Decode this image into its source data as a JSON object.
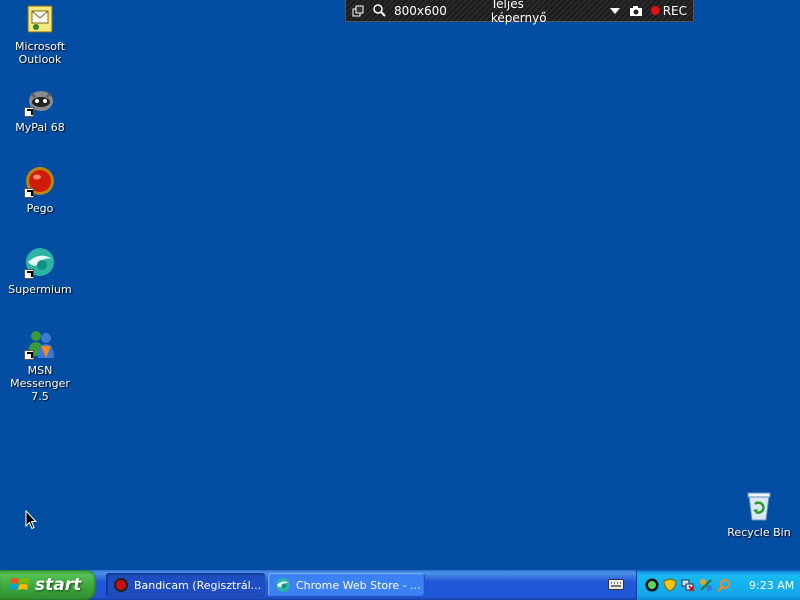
{
  "desktop": {
    "background_color": "#034ea2",
    "icons": [
      {
        "label": "Microsoft\nOutlook",
        "icon": "outlook-icon"
      },
      {
        "label": "MyPal 68",
        "icon": "mypal-icon"
      },
      {
        "label": "Pego",
        "icon": "pego-icon"
      },
      {
        "label": "Supermium",
        "icon": "supermium-icon"
      },
      {
        "label": "MSN Messenger\n7.5",
        "icon": "msn-messenger-icon"
      },
      {
        "label": "Recycle Bin",
        "icon": "recycle-bin-icon"
      }
    ]
  },
  "recorder_bar": {
    "resolution": "800x600",
    "mode": "Teljes képernyő",
    "rec_label": "REC"
  },
  "taskbar": {
    "start_label": "start",
    "tasks": [
      {
        "label": "Bandicam (Regisztrál...",
        "icon": "bandicam-icon",
        "active": true
      },
      {
        "label": "Chrome Web Store - ...",
        "icon": "chrome-icon",
        "active": false
      }
    ],
    "clock": "9:23 AM"
  }
}
